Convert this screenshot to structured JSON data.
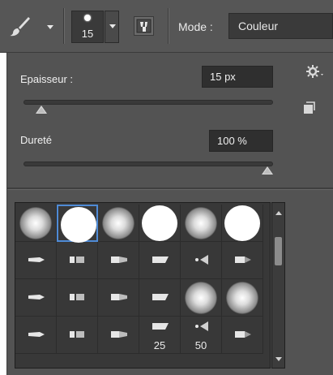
{
  "toolbar": {
    "brush_size": "15",
    "mode_label": "Mode :",
    "mode_value": "Couleur"
  },
  "panel": {
    "thickness_label": "Epaisseur :",
    "thickness_value": "15 px",
    "thickness_fraction": 0.05,
    "hardness_label": "Dureté",
    "hardness_value": "100 %",
    "hardness_fraction": 1.0
  },
  "icons": {
    "tool": "brush-icon",
    "toggle": "brush-panel-toggle-icon",
    "settings": "gear-icon",
    "new_preset": "new-preset-icon"
  },
  "presets": [
    {
      "kind": "soft"
    },
    {
      "kind": "hard",
      "selected": true
    },
    {
      "kind": "soft"
    },
    {
      "kind": "hard"
    },
    {
      "kind": "soft"
    },
    {
      "kind": "hard"
    },
    {
      "kind": "tip"
    },
    {
      "kind": "tip"
    },
    {
      "kind": "tip"
    },
    {
      "kind": "tip"
    },
    {
      "kind": "tip"
    },
    {
      "kind": "tip"
    },
    {
      "kind": "tip"
    },
    {
      "kind": "tip"
    },
    {
      "kind": "tip"
    },
    {
      "kind": "tip"
    },
    {
      "kind": "soft"
    },
    {
      "kind": "soft"
    },
    {
      "kind": "tip"
    },
    {
      "kind": "tip"
    },
    {
      "kind": "tip"
    },
    {
      "kind": "tip",
      "label": "25"
    },
    {
      "kind": "tip",
      "label": "50"
    },
    {
      "kind": "tip"
    }
  ],
  "colors": {
    "selection": "#4f8bd6",
    "panel": "#535353"
  }
}
